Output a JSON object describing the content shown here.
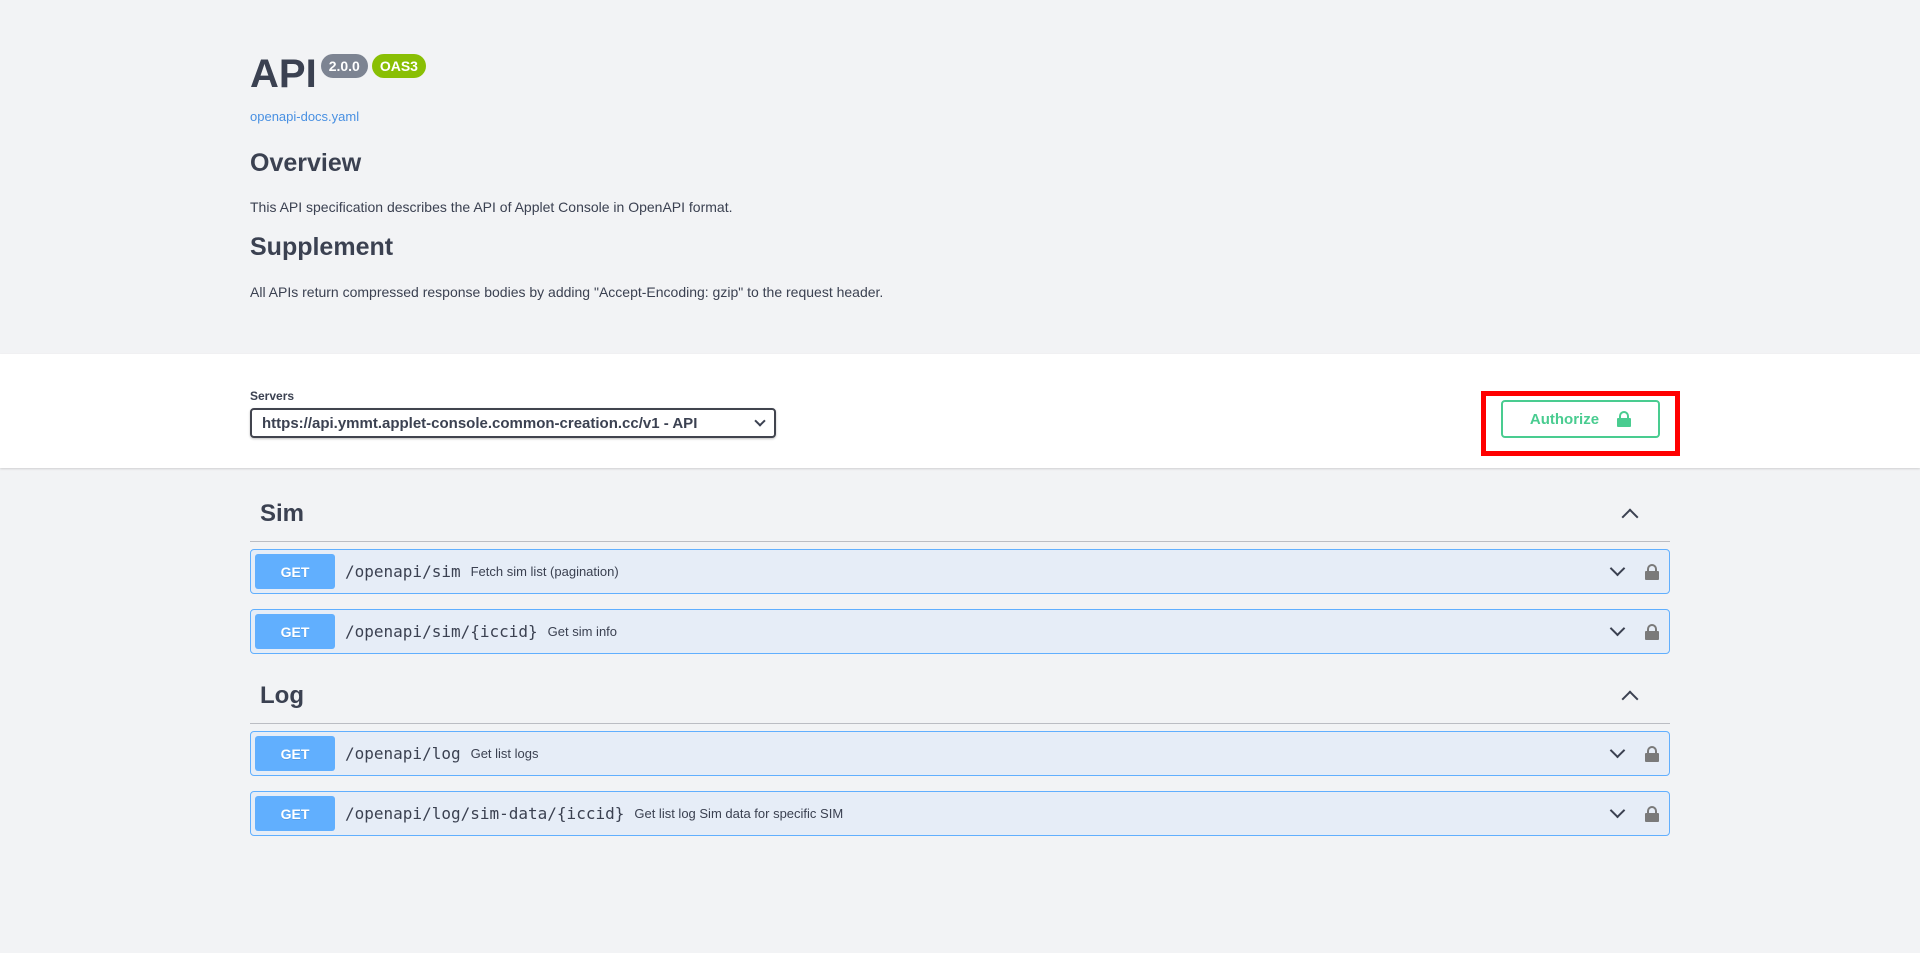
{
  "info": {
    "title": "API",
    "version_badge": "2.0.0",
    "oas_badge": "OAS3",
    "spec_link": "openapi-docs.yaml",
    "overview_heading": "Overview",
    "overview_text": "This API specification describes the API of Applet Console in OpenAPI format.",
    "supplement_heading": "Supplement",
    "supplement_text": "All APIs return compressed response bodies by adding \"Accept-Encoding: gzip\" to the request header."
  },
  "servers": {
    "label": "Servers",
    "selected": "https://api.ymmt.applet-console.common-creation.cc/v1 - API"
  },
  "authorize": {
    "label": "Authorize",
    "icon": "unlocked-lock-icon"
  },
  "tags": [
    {
      "name": "Sim",
      "operations": [
        {
          "method": "GET",
          "path": "/openapi/sim",
          "summary": "Fetch sim list (pagination)"
        },
        {
          "method": "GET",
          "path": "/openapi/sim/{iccid}",
          "summary": "Get sim info"
        }
      ]
    },
    {
      "name": "Log",
      "operations": [
        {
          "method": "GET",
          "path": "/openapi/log",
          "summary": "Get list logs"
        },
        {
          "method": "GET",
          "path": "/openapi/log/sim-data/{iccid}",
          "summary": "Get list log Sim data for specific SIM"
        }
      ]
    }
  ],
  "colors": {
    "get": "#61affe",
    "authorize": "#49cc90",
    "highlight": "#ff0000"
  }
}
